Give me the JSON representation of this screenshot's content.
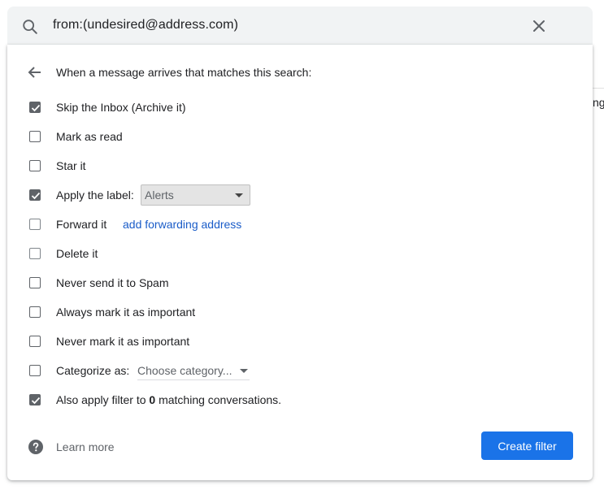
{
  "search": {
    "query": "from:(undesired@address.com)"
  },
  "background": {
    "partial_text": "ng"
  },
  "filter": {
    "header": "When a message arrives that matches this search:",
    "options": [
      {
        "label": "Skip the Inbox (Archive it)",
        "checked": true
      },
      {
        "label": "Mark as read",
        "checked": false
      },
      {
        "label": "Star it",
        "checked": false
      },
      {
        "label": "Apply the label:",
        "checked": true
      },
      {
        "label": "Forward it",
        "checked": false
      },
      {
        "label": "Delete it",
        "checked": false
      },
      {
        "label": "Never send it to Spam",
        "checked": false
      },
      {
        "label": "Always mark it as important",
        "checked": false
      },
      {
        "label": "Never mark it as important",
        "checked": false
      },
      {
        "label": "Categorize as:",
        "checked": false
      },
      {
        "label_prefix": "Also apply filter to",
        "count": "0",
        "label_suffix": "matching conversations.",
        "checked": true
      }
    ],
    "label_select_value": "Alerts",
    "forward_link": "add forwarding address",
    "category_select_value": "Choose category..."
  },
  "footer": {
    "learn_more": "Learn more",
    "create_button": "Create filter"
  },
  "colors": {
    "primary": "#1a73e8",
    "link": "#1a5cc8",
    "checkbox": "#5f6368",
    "searchbar_bg": "#f1f3f4"
  },
  "icons": [
    "search-icon",
    "close-icon",
    "arrow-back-icon",
    "check-icon",
    "help-icon",
    "dropdown-caret-icon"
  ]
}
